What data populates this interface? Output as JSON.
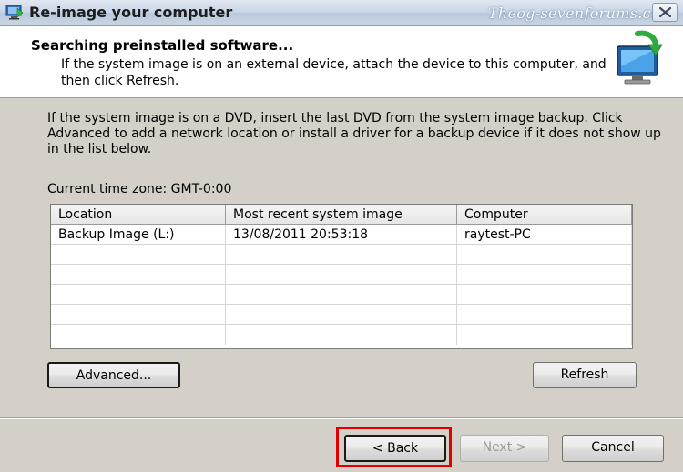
{
  "window": {
    "title": "Re-image your computer",
    "watermark": "Theog-sevenforums.com"
  },
  "header": {
    "heading": "Searching preinstalled software...",
    "subtext": "If the system image is on an external device, attach the device to this computer, and then click Refresh."
  },
  "body": {
    "instructions": "If the system image is on a DVD, insert the last DVD from the system image backup. Click Advanced to add a network location or install a driver for a backup device if it does not show up in the list below.",
    "timezone": "Current time zone: GMT-0:00"
  },
  "table": {
    "columns": [
      "Location",
      "Most recent system image",
      "Computer"
    ],
    "rows": [
      [
        "Backup Image (L:)",
        "13/08/2011 20:53:18",
        "raytest-PC"
      ]
    ]
  },
  "buttons": {
    "advanced": "Advanced...",
    "refresh": "Refresh",
    "back": "< Back",
    "next": "Next >",
    "cancel": "Cancel"
  },
  "icons": {
    "app": "backup-computer-icon",
    "header": "computer-restore-icon",
    "close": "close-icon"
  },
  "colors": {
    "highlight": "#e00000",
    "dialog_bg": "#d4d0c8"
  }
}
